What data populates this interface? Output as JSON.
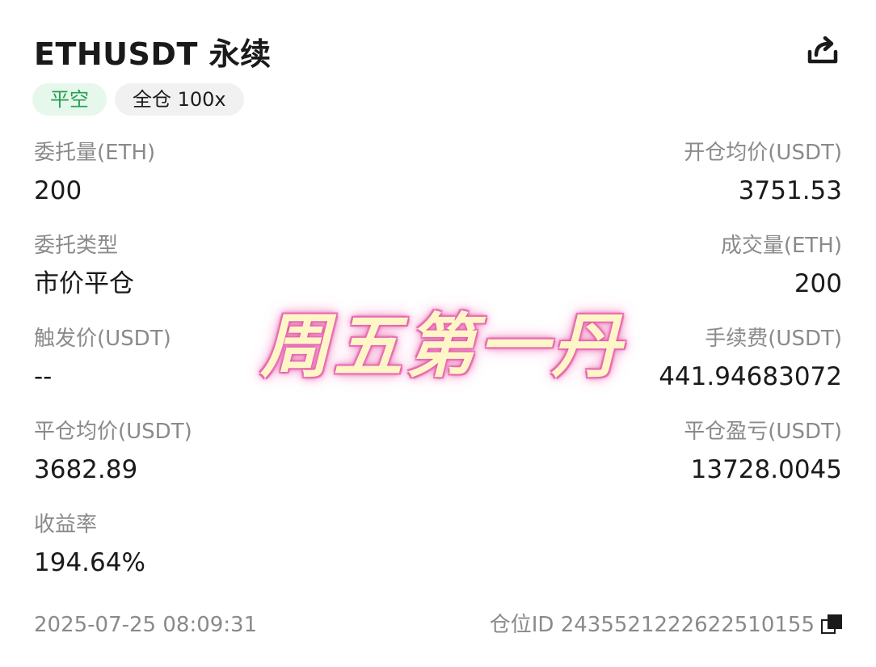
{
  "header": {
    "title": "ETHUSDT 永续",
    "share_icon": "share-icon"
  },
  "badges": {
    "direction": "平空",
    "mode": "全仓 100x"
  },
  "colors": {
    "green_text": "#22a04f",
    "green_bg": "#e6f7ec",
    "label_gray": "#8a8a8a"
  },
  "fields": {
    "order_qty": {
      "label": "委托量(ETH)",
      "value": "200"
    },
    "open_avg_price": {
      "label": "开仓均价(USDT)",
      "value": "3751.53"
    },
    "order_type": {
      "label": "委托类型",
      "value": "市价平仓"
    },
    "filled_qty": {
      "label": "成交量(ETH)",
      "value": "200"
    },
    "trigger_price": {
      "label": "触发价(USDT)",
      "value": "--"
    },
    "fee": {
      "label": "手续费(USDT)",
      "value": "441.94683072"
    },
    "close_avg_price": {
      "label": "平仓均价(USDT)",
      "value": "3682.89"
    },
    "close_pnl": {
      "label": "平仓盈亏(USDT)",
      "value": "13728.0045"
    },
    "roi": {
      "label": "收益率",
      "value": "194.64%"
    }
  },
  "footer": {
    "timestamp": "2025-07-25 08:09:31",
    "position_id": "仓位ID 2435521222622510155",
    "copy_icon": "copy-icon"
  },
  "watermark": {
    "text": "周五第一丹"
  }
}
